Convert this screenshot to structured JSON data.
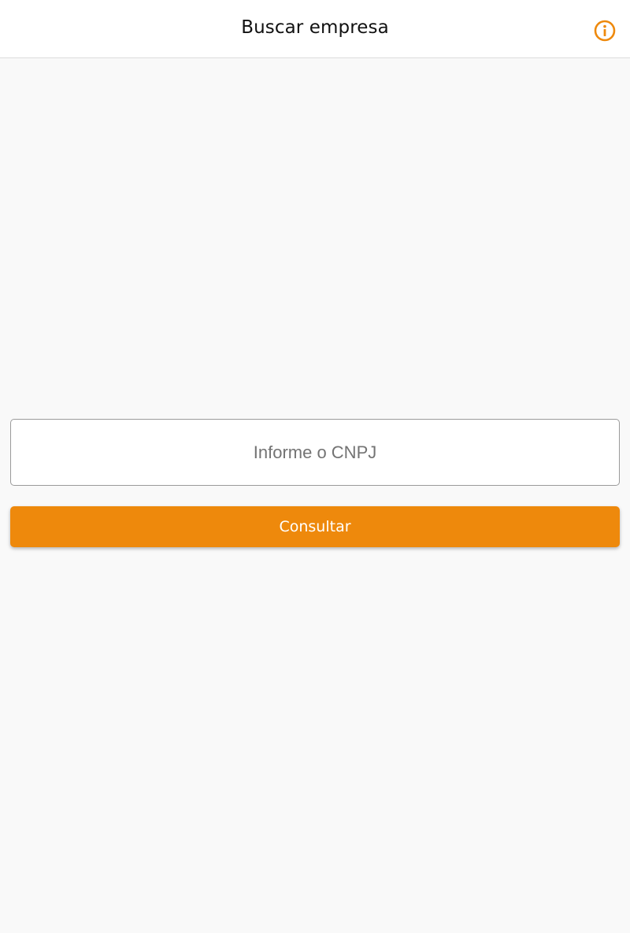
{
  "app_bar": {
    "title": "Buscar empresa",
    "info_icon": "info-circle-icon"
  },
  "form": {
    "cnpj_placeholder": "Informe o CNPJ",
    "cnpj_value": "",
    "submit_label": "Consultar"
  },
  "colors": {
    "accent": "#ee890c",
    "background": "#f9f9f9",
    "app_bar": "#ffffff"
  }
}
